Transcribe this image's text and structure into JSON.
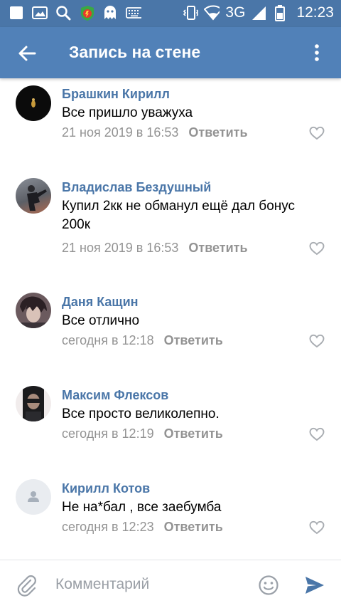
{
  "status_bar": {
    "network": "3G",
    "time": "12:23"
  },
  "header": {
    "title": "Запись на стене",
    "colors": {
      "statusbar": "#4a76a8",
      "appbar": "#5181b8"
    }
  },
  "comments": [
    {
      "author": "Брашкин Кирилл",
      "text": "Все пришло уважуха",
      "time": "21 ноя 2019 в 16:53",
      "reply": "Ответить"
    },
    {
      "author": "Владислав Бездушный",
      "text": "Купил 2кк не обманул ещё дал бонус 200к",
      "time": "21 ноя 2019 в 16:53",
      "reply": "Ответить"
    },
    {
      "author": "Даня Кащин",
      "text": "Все отлично",
      "time": "сегодня в 12:18",
      "reply": "Ответить"
    },
    {
      "author": "Максим Флексов",
      "text": "Все просто великолепно.",
      "time": "сегодня в 12:19",
      "reply": "Ответить"
    },
    {
      "author": "Кирилл Котов",
      "text": "Не на*бал , все заебумба",
      "time": "сегодня в 12:23",
      "reply": "Ответить"
    }
  ],
  "composer": {
    "placeholder": "Комментарий",
    "accent": "#4a76a8"
  }
}
